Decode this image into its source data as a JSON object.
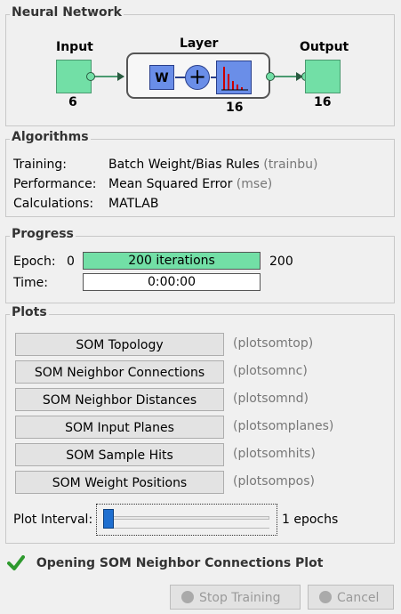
{
  "neural_network": {
    "title": "Neural Network",
    "input_label": "Input",
    "input_size": "6",
    "layer_label": "Layer",
    "layer_size": "16",
    "weight_symbol": "W",
    "sum_symbol": "+",
    "output_label": "Output",
    "output_size": "16"
  },
  "algorithms": {
    "title": "Algorithms",
    "rows": [
      {
        "key": "Training:",
        "value": "Batch Weight/Bias Rules",
        "code": "(trainbu)"
      },
      {
        "key": "Performance:",
        "value": "Mean Squared Error",
        "code": "(mse)"
      },
      {
        "key": "Calculations:",
        "value": "MATLAB",
        "code": ""
      }
    ]
  },
  "progress": {
    "title": "Progress",
    "epoch_label": "Epoch:",
    "epoch_start": "0",
    "epoch_text": "200 iterations",
    "epoch_end": "200",
    "epoch_fraction": 1.0,
    "time_label": "Time:",
    "time_value": "0:00:00"
  },
  "plots": {
    "title": "Plots",
    "buttons": [
      {
        "label": "SOM Topology",
        "fn": "(plotsomtop)"
      },
      {
        "label": "SOM Neighbor Connections",
        "fn": "(plotsomnc)"
      },
      {
        "label": "SOM Neighbor Distances",
        "fn": "(plotsomnd)"
      },
      {
        "label": "SOM Input Planes",
        "fn": "(plotsomplanes)"
      },
      {
        "label": "SOM Sample Hits",
        "fn": "(plotsomhits)"
      },
      {
        "label": "SOM Weight Positions",
        "fn": "(plotsompos)"
      }
    ],
    "interval_label": "Plot Interval:",
    "interval_value": "1 epochs"
  },
  "status": {
    "message": "Opening SOM Neighbor Connections Plot",
    "icon": "check-icon",
    "color": "#2e9a2e"
  },
  "actions": {
    "stop_training": "Stop Training",
    "cancel": "Cancel"
  },
  "colors": {
    "accent_green": "#72dfa6",
    "accent_blue": "#6a8ee8",
    "slider_thumb": "#1f6fd0"
  }
}
